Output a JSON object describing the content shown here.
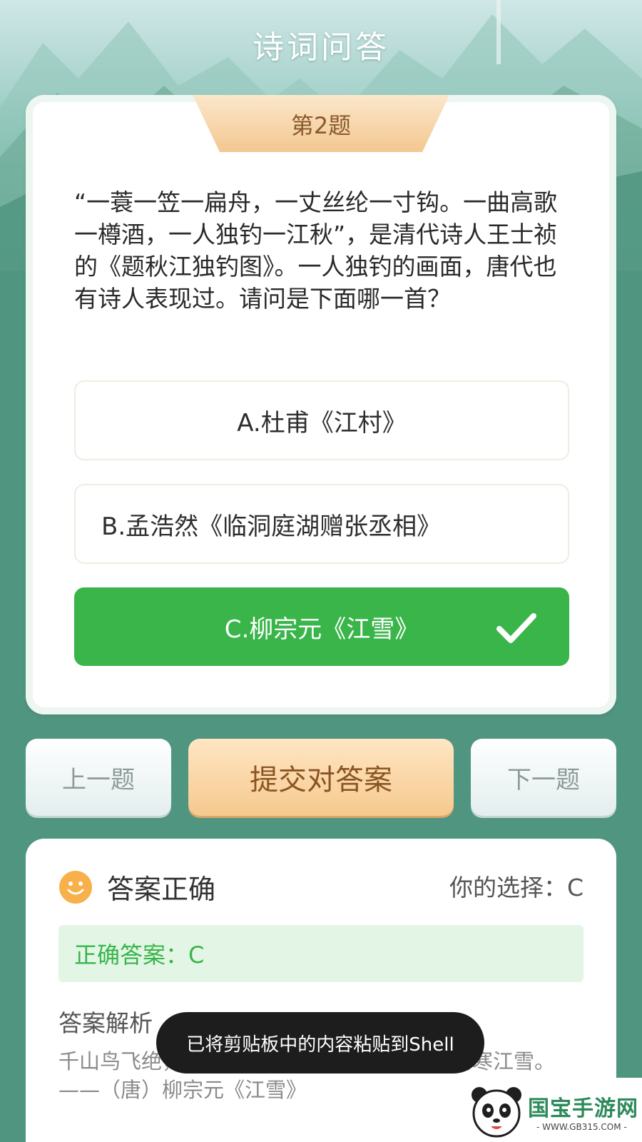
{
  "header": {
    "title": "诗词问答"
  },
  "question": {
    "number_label": "第2题",
    "text": "“一蓑一笠一扁舟，一丈丝纶一寸钩。一曲高歌一樽酒，一人独钓一江秋”，是清代诗人王士祯的《题秋江独钓图》。一人独钓的画面，唐代也有诗人表现过。请问是下面哪一首？",
    "options": [
      {
        "label": "A.杜甫《江村》"
      },
      {
        "label": "B.孟浩然《临洞庭湖赠张丞相》"
      },
      {
        "label": "C.柳宗元《江雪》",
        "selected": true,
        "check_icon": "check-icon"
      }
    ]
  },
  "nav": {
    "prev_label": "上一题",
    "submit_label": "提交对答案",
    "next_label": "下一题"
  },
  "result": {
    "status_icon": "smile-icon",
    "status": "答案正确",
    "your_choice": "你的选择：C",
    "correct_answer": "正确答案：C",
    "analysis_title": "答案解析",
    "analysis_text": "千山鸟飞绝，万径人踪灭。孤舟蓑笠翁，独钓寒江雪。——（唐）柳宗元《江雪》"
  },
  "toast": {
    "text": "已将剪贴板中的内容粘贴到Shell"
  },
  "watermark": {
    "name": "国宝手游网",
    "url": "- WWW.GB315.COM -",
    "icon": "panda-logo-icon"
  },
  "colors": {
    "background": "#4f9580",
    "correct_green": "#39b54a",
    "accent_orange": "#f6c98e",
    "correct_box": "#e3f6e6"
  }
}
